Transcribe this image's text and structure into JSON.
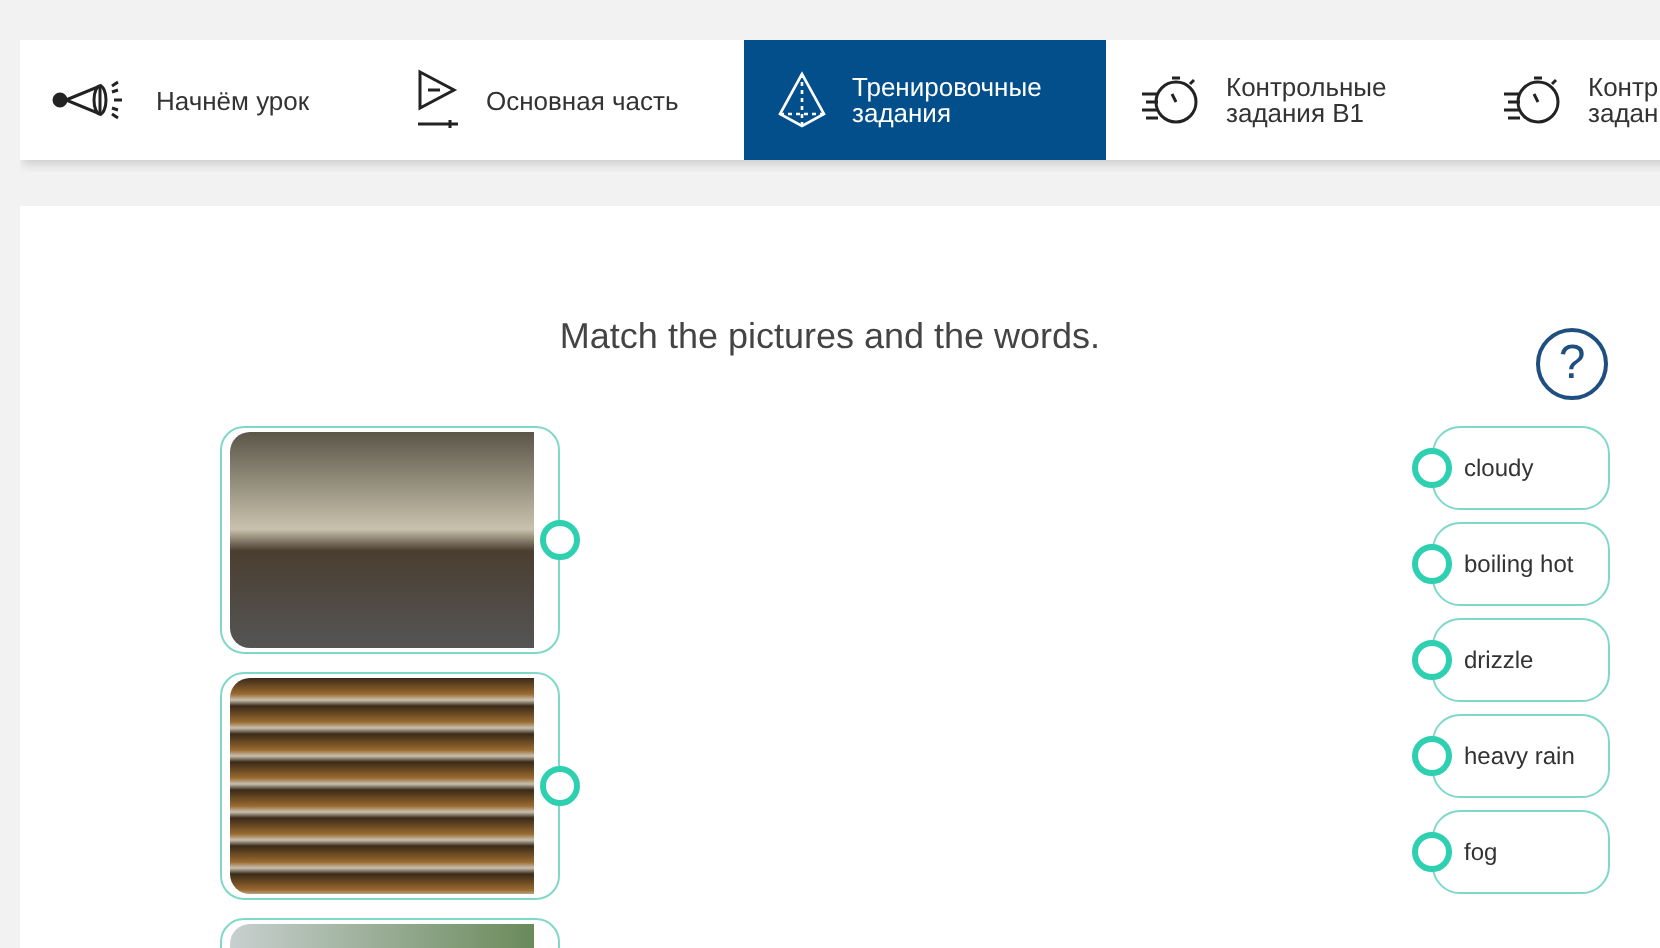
{
  "tabs": [
    {
      "kind": "speaker",
      "lines": [
        "Начнём урок"
      ],
      "selected": false
    },
    {
      "kind": "play",
      "lines": [
        "Основная часть"
      ],
      "selected": false
    },
    {
      "kind": "pyramid",
      "lines": [
        "Тренировочные",
        "задания"
      ],
      "selected": true
    },
    {
      "kind": "stopwatch",
      "lines": [
        "Контрольные",
        "задания B1"
      ],
      "selected": false
    },
    {
      "kind": "stopwatch",
      "lines": [
        "Контр",
        "задан"
      ],
      "selected": false
    }
  ],
  "exercise": {
    "instruction": "Match the pictures and the words.",
    "help": "?",
    "pictures": [
      {
        "kind": "photo"
      },
      {
        "kind": "photo"
      },
      {
        "kind": "photo"
      }
    ],
    "words": [
      "cloudy",
      "boiling hot",
      "drizzle",
      "heavy rain",
      "fog"
    ]
  }
}
